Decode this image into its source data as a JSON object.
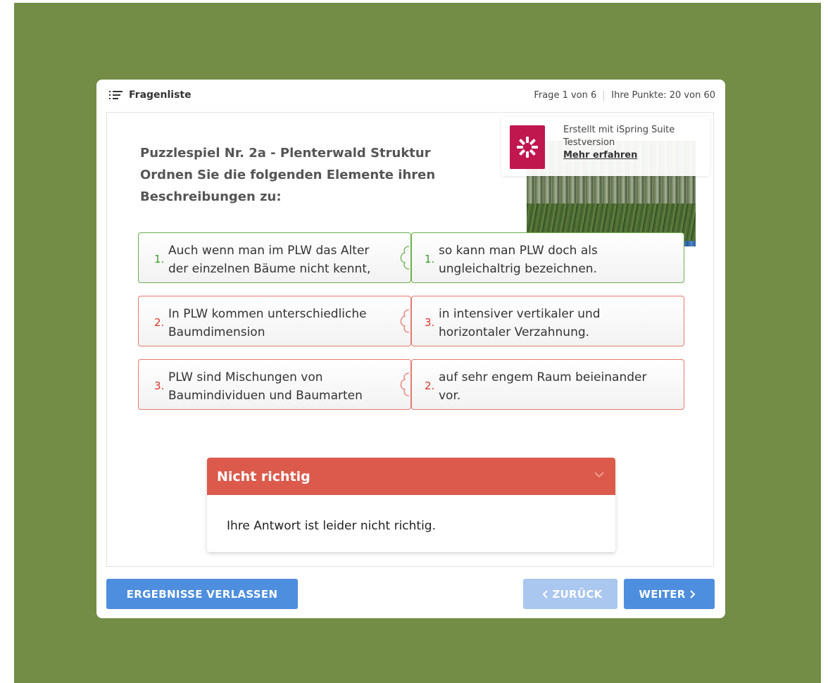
{
  "header": {
    "question_list_label": "Fragenliste",
    "question_counter": "Frage 1 von 6",
    "score": "Ihre Punkte: 20 von 60"
  },
  "question": {
    "title": "Puzzlespiel Nr. 2a - Plenterwald Struktur",
    "line2": "Ordnen Sie die folgenden Elemente ihren",
    "line3": "Beschreibungen zu:"
  },
  "watermark": {
    "line1": "Erstellt mit iSpring Suite",
    "line2": "Testversion",
    "link": "Mehr erfahren"
  },
  "pairs": [
    {
      "status": "correct",
      "left_num": "1.",
      "left_line1": "Auch wenn man im PLW das Alter",
      "left_line2": "der einzelnen Bäume nicht kennt,",
      "right_num": "1.",
      "right_line1": "so kann man PLW doch als",
      "right_line2": "ungleichaltrig bezeichnen."
    },
    {
      "status": "incorrect",
      "left_num": "2.",
      "left_line1": "In PLW kommen unterschiedliche",
      "left_line2": "Baumdimension",
      "right_num": "3.",
      "right_line1": "in intensiver vertikaler und",
      "right_line2": "horizontaler Verzahnung."
    },
    {
      "status": "incorrect",
      "left_num": "3.",
      "left_line1": "PLW sind Mischungen von",
      "left_line2": "Baumindividuen und Baumarten",
      "right_num": "2.",
      "right_line1": "auf sehr engem Raum beieinander",
      "right_line2": "vor."
    }
  ],
  "feedback": {
    "title": "Nicht richtig",
    "message": "Ihre Antwort ist leider nicht richtig."
  },
  "buttons": {
    "exit": "ERGEBNISSE VERLASSEN",
    "back": "ZURÜCK",
    "next": "WEITER"
  },
  "colors": {
    "background": "#738c46",
    "correct": "#6ab04c",
    "incorrect": "#e5796f",
    "feedback_header": "#dc5a4c",
    "primary_button": "#4e8ede",
    "disabled_button": "#a9c7ef",
    "brand_logo": "#c0174f"
  },
  "icons": {
    "question_list": "list-icon",
    "logo": "ispring-logo-icon",
    "collapse": "chevron-down-icon",
    "back": "chevron-left-icon",
    "next": "chevron-right-icon"
  }
}
